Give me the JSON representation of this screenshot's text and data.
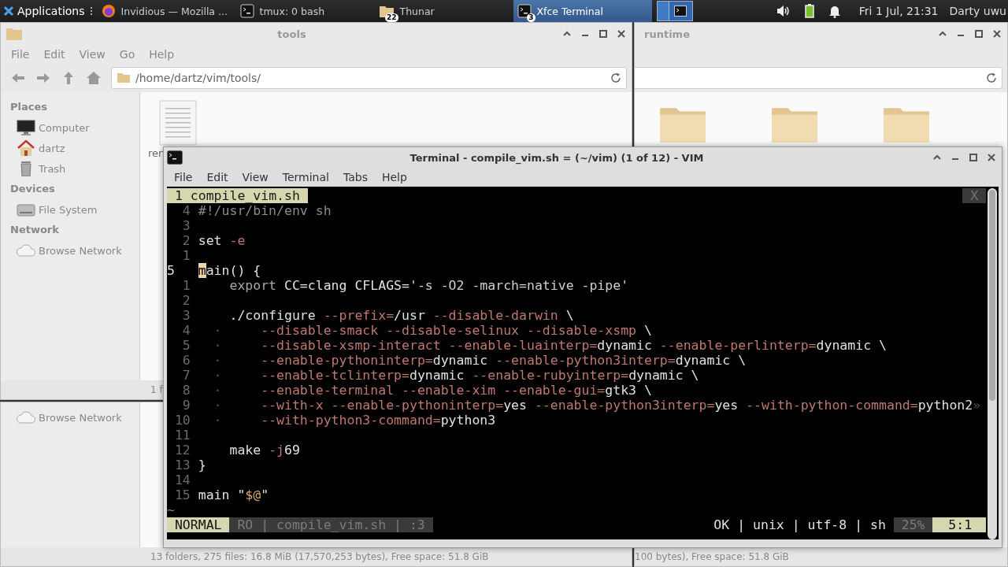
{
  "panel": {
    "menu_label": "Applications",
    "tasks": [
      {
        "kind": "browser",
        "title": "Invidious — Mozilla ...",
        "selected": false
      },
      {
        "kind": "terminal",
        "title": "tmux: 0 bash",
        "selected": false
      },
      {
        "kind": "folder",
        "title": "Thunar",
        "badge": "22",
        "selected": false
      },
      {
        "kind": "terminal",
        "title": "Xfce Terminal",
        "badge": "3",
        "selected": true
      }
    ],
    "clock": "Fri 1 Jul, 21:31",
    "user": "Darty uwu"
  },
  "file_manager_tools": {
    "title": "tools",
    "menu": [
      "File",
      "Edit",
      "View",
      "Go",
      "Help"
    ],
    "location": "/home/dartz/vim/tools/",
    "sidebar": [
      {
        "heading": "Places",
        "items": [
          {
            "kind": "computer",
            "label": "Computer"
          },
          {
            "kind": "home",
            "label": "dartz"
          },
          {
            "kind": "trash",
            "label": "Trash"
          }
        ]
      },
      {
        "heading": "Devices",
        "items": [
          {
            "kind": "drive",
            "label": "File System"
          }
        ]
      },
      {
        "heading": "Network",
        "items": [
          {
            "kind": "network",
            "label": "Browse Network"
          }
        ]
      }
    ],
    "file_label": "ren",
    "status": "1 f"
  },
  "file_manager_lower": {
    "sidebar_items": [
      {
        "kind": "network",
        "label": "Browse Network"
      }
    ],
    "status": "13 folders, 275 files: 16.8 MiB (17,570,253 bytes), Free space: 51.8 GiB"
  },
  "file_manager_runtime": {
    "title": "runtime",
    "folders": [
      {
        "kind": "folder"
      },
      {
        "kind": "folder"
      },
      {
        "kind": "folder"
      }
    ],
    "status": "100 bytes), Free space: 51.8 GiB"
  },
  "terminal": {
    "title": "Terminal - compile_vim.sh = (~/vim) (1 of 12) - VIM",
    "menu": [
      "File",
      "Edit",
      "View",
      "Terminal",
      "Tabs",
      "Help"
    ],
    "vim": {
      "tabs": [
        {
          "label": "1 compile_vim.sh",
          "selected": true
        }
      ],
      "close": "X",
      "lines": [
        {
          "number": "4",
          "current": false,
          "segments": [
            {
              "kind": "comment",
              "text": "#!/usr/bin/env sh"
            }
          ]
        },
        {
          "number": "3",
          "current": false
        },
        {
          "number": "2",
          "current": false,
          "segments": [
            {
              "kind": "plain",
              "text": "set "
            },
            {
              "kind": "option",
              "text": "-e"
            }
          ]
        },
        {
          "number": "1",
          "current": false
        },
        {
          "number": "5",
          "current": true,
          "segments": [
            {
              "kind": "cursor",
              "text": "m"
            },
            {
              "kind": "plain",
              "text": "ain() {"
            }
          ]
        },
        {
          "number": "1",
          "current": false,
          "segments": [
            {
              "kind": "keyword",
              "text": "    export "
            },
            {
              "kind": "plain",
              "text": "CC=clang CFLAGS="
            },
            {
              "kind": "string",
              "text": "'-s -O2 -march=native -pipe'"
            }
          ]
        },
        {
          "number": "2",
          "current": false
        },
        {
          "number": "3",
          "current": false,
          "segments": [
            {
              "kind": "plain",
              "text": "    ./configure "
            },
            {
              "kind": "option",
              "text": "--prefix="
            },
            {
              "kind": "plain",
              "text": "/usr "
            },
            {
              "kind": "option",
              "text": "--disable-darwin "
            },
            {
              "kind": "plain",
              "text": "\\"
            }
          ]
        },
        {
          "number": "4",
          "current": false,
          "segments": [
            {
              "kind": "listchar",
              "text": "  ·     "
            },
            {
              "kind": "option",
              "text": "--disable-smack --disable-selinux --disable-xsmp "
            },
            {
              "kind": "plain",
              "text": "\\"
            }
          ]
        },
        {
          "number": "5",
          "current": false,
          "segments": [
            {
              "kind": "listchar",
              "text": "  ·     "
            },
            {
              "kind": "option",
              "text": "--disable-xsmp-interact --enable-luainterp="
            },
            {
              "kind": "plain",
              "text": "dynamic "
            },
            {
              "kind": "option",
              "text": "--enable-perlinterp="
            },
            {
              "kind": "plain",
              "text": "dynamic \\"
            }
          ]
        },
        {
          "number": "6",
          "current": false,
          "segments": [
            {
              "kind": "listchar",
              "text": "  ·     "
            },
            {
              "kind": "option",
              "text": "--enable-pythoninterp="
            },
            {
              "kind": "plain",
              "text": "dynamic "
            },
            {
              "kind": "option",
              "text": "--enable-python3interp="
            },
            {
              "kind": "plain",
              "text": "dynamic \\"
            }
          ]
        },
        {
          "number": "7",
          "current": false,
          "segments": [
            {
              "kind": "listchar",
              "text": "  ·     "
            },
            {
              "kind": "option",
              "text": "--enable-tclinterp="
            },
            {
              "kind": "plain",
              "text": "dynamic "
            },
            {
              "kind": "option",
              "text": "--enable-rubyinterp="
            },
            {
              "kind": "plain",
              "text": "dynamic \\"
            }
          ]
        },
        {
          "number": "8",
          "current": false,
          "segments": [
            {
              "kind": "listchar",
              "text": "  ·     "
            },
            {
              "kind": "option",
              "text": "--enable-terminal --enable-xim --enable-gui="
            },
            {
              "kind": "plain",
              "text": "gtk3 \\"
            }
          ]
        },
        {
          "number": "9",
          "current": false,
          "segments": [
            {
              "kind": "listchar",
              "text": "  ·     "
            },
            {
              "kind": "option",
              "text": "--with-x --enable-pythoninterp="
            },
            {
              "kind": "plain",
              "text": "yes "
            },
            {
              "kind": "option",
              "text": "--enable-python3interp="
            },
            {
              "kind": "plain",
              "text": "yes "
            },
            {
              "kind": "option",
              "text": "--with-python-command="
            },
            {
              "kind": "plain",
              "text": "python2"
            },
            {
              "kind": "listchar",
              "text": "»"
            }
          ]
        },
        {
          "number": "10",
          "current": false,
          "segments": [
            {
              "kind": "listchar",
              "text": "  ·     "
            },
            {
              "kind": "option",
              "text": "--with-python3-command="
            },
            {
              "kind": "plain",
              "text": "python3"
            }
          ]
        },
        {
          "number": "11",
          "current": false
        },
        {
          "number": "12",
          "current": false,
          "segments": [
            {
              "kind": "plain",
              "text": "    make "
            },
            {
              "kind": "option",
              "text": "-j"
            },
            {
              "kind": "plain",
              "text": "69"
            }
          ]
        },
        {
          "number": "13",
          "current": false,
          "segments": [
            {
              "kind": "plain",
              "text": "}"
            }
          ]
        },
        {
          "number": "14",
          "current": false
        },
        {
          "number": "15",
          "current": false,
          "segments": [
            {
              "kind": "plain",
              "text": "main \""
            },
            {
              "kind": "special",
              "text": "$@"
            },
            {
              "kind": "plain",
              "text": "\""
            }
          ]
        }
      ],
      "filler": "~",
      "statusline": {
        "mode": "NORMAL",
        "file_info": "RO | compile_vim.sh | :3",
        "file_format": "OK | unix | utf-8 | sh",
        "percent": "25%",
        "position": "5:1"
      }
    }
  }
}
